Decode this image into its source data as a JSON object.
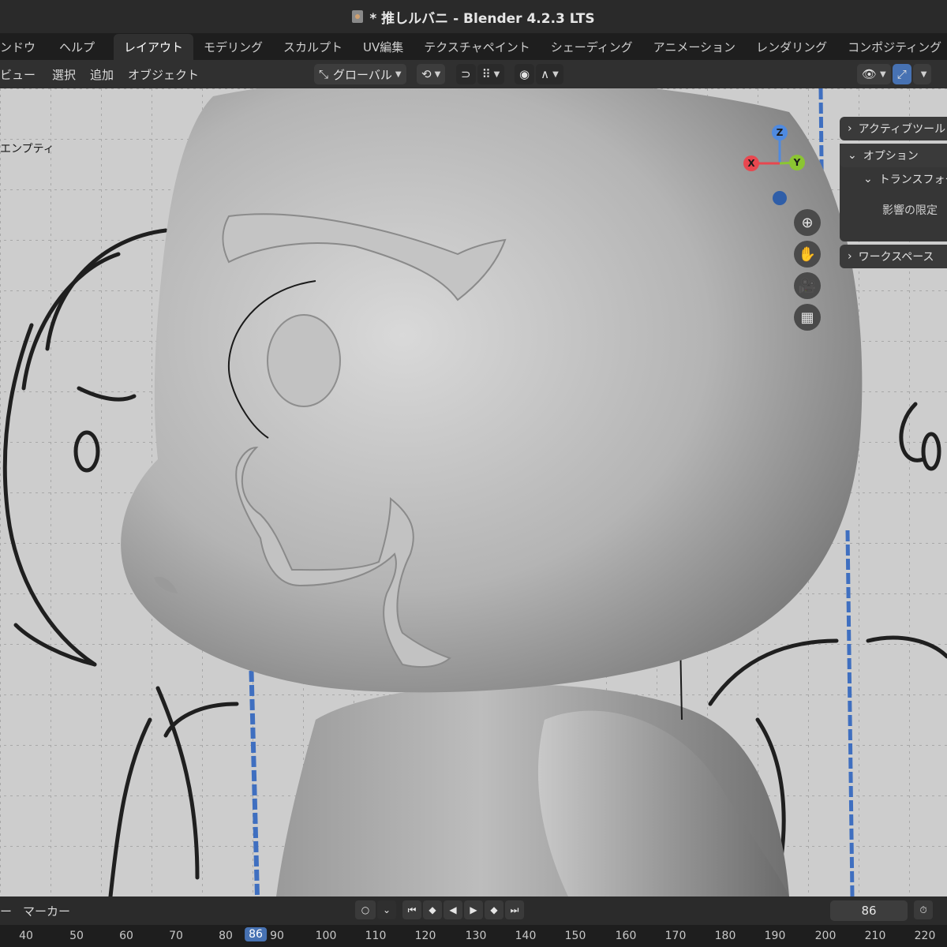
{
  "window": {
    "title": "* 推しルバニ - Blender 4.2.3 LTS"
  },
  "menubar": {
    "menus": [
      "ンドウ",
      "ヘルプ"
    ],
    "workspace_tabs": [
      "レイアウト",
      "モデリング",
      "スカルプト",
      "UV編集",
      "テクスチャペイント",
      "シェーディング",
      "アニメーション",
      "レンダリング",
      "コンポジティング"
    ],
    "active_tab": "レイアウト"
  },
  "viewport_header": {
    "menus": [
      "ビュー",
      "選択",
      "追加",
      "オブジェクト"
    ],
    "transform_orientation": "グローバル"
  },
  "viewport": {
    "object_label": "エンプティ",
    "gizmo": {
      "x": "X",
      "y": "Y",
      "z": "Z"
    },
    "axis_colors": {
      "x": "#e8474f",
      "y": "#8bc532",
      "z": "#4f8ae0"
    }
  },
  "sidebar": {
    "active_tool": "アクティブツール",
    "options": "オプション",
    "transform": "トランスフォーム",
    "affect_only": "影響の限定",
    "workspace": "ワークスペース"
  },
  "timeline": {
    "marker_label": "マーカー",
    "current_frame": "86",
    "ruler_labels": [
      "40",
      "50",
      "60",
      "70",
      "80",
      "90",
      "100",
      "110",
      "120",
      "130",
      "140",
      "150",
      "160",
      "170",
      "180",
      "190",
      "200",
      "210",
      "220"
    ],
    "current_frame_badge": "86"
  },
  "colors": {
    "accent": "#4772b3",
    "header_bg": "#303030"
  }
}
